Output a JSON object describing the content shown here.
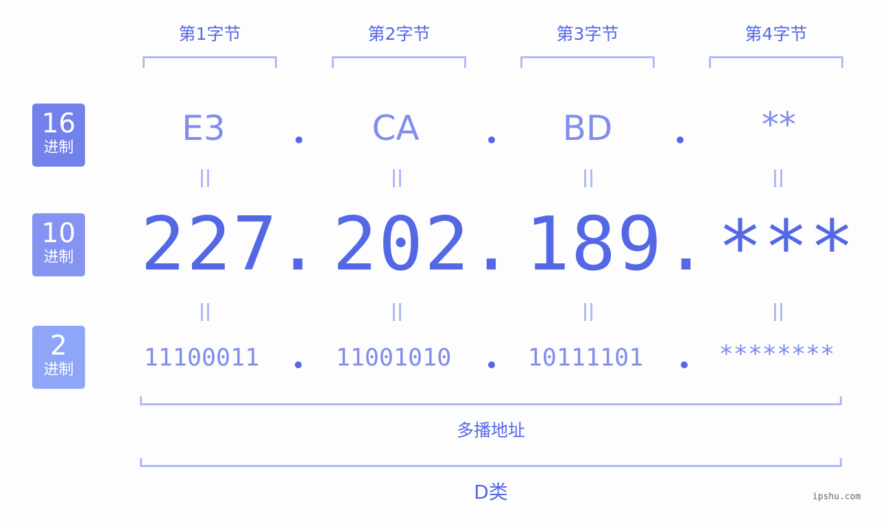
{
  "byte_titles": [
    "第1字节",
    "第2字节",
    "第3字节",
    "第4字节"
  ],
  "rows": {
    "hex": {
      "badge_number": "16",
      "badge_label": "进制",
      "badge_color": "#7381ea",
      "values": [
        "E3",
        "CA",
        "BD",
        "**"
      ]
    },
    "dec": {
      "badge_number": "10",
      "badge_label": "进制",
      "badge_color": "#8593f1",
      "values": [
        "227",
        "202",
        "189",
        "***"
      ]
    },
    "bin": {
      "badge_number": "2",
      "badge_label": "进制",
      "badge_color": "#8fa6f8",
      "values": [
        "11100011",
        "11001010",
        "10111101",
        "********"
      ]
    }
  },
  "separator": ".",
  "equals_symbol": "=",
  "captions": {
    "address_type": "多播地址",
    "address_class": "D类"
  },
  "watermark": "ipshu.com",
  "colors": {
    "primary": "#5468e6",
    "secondary": "#818cec",
    "bracket": "#b0baf7"
  }
}
